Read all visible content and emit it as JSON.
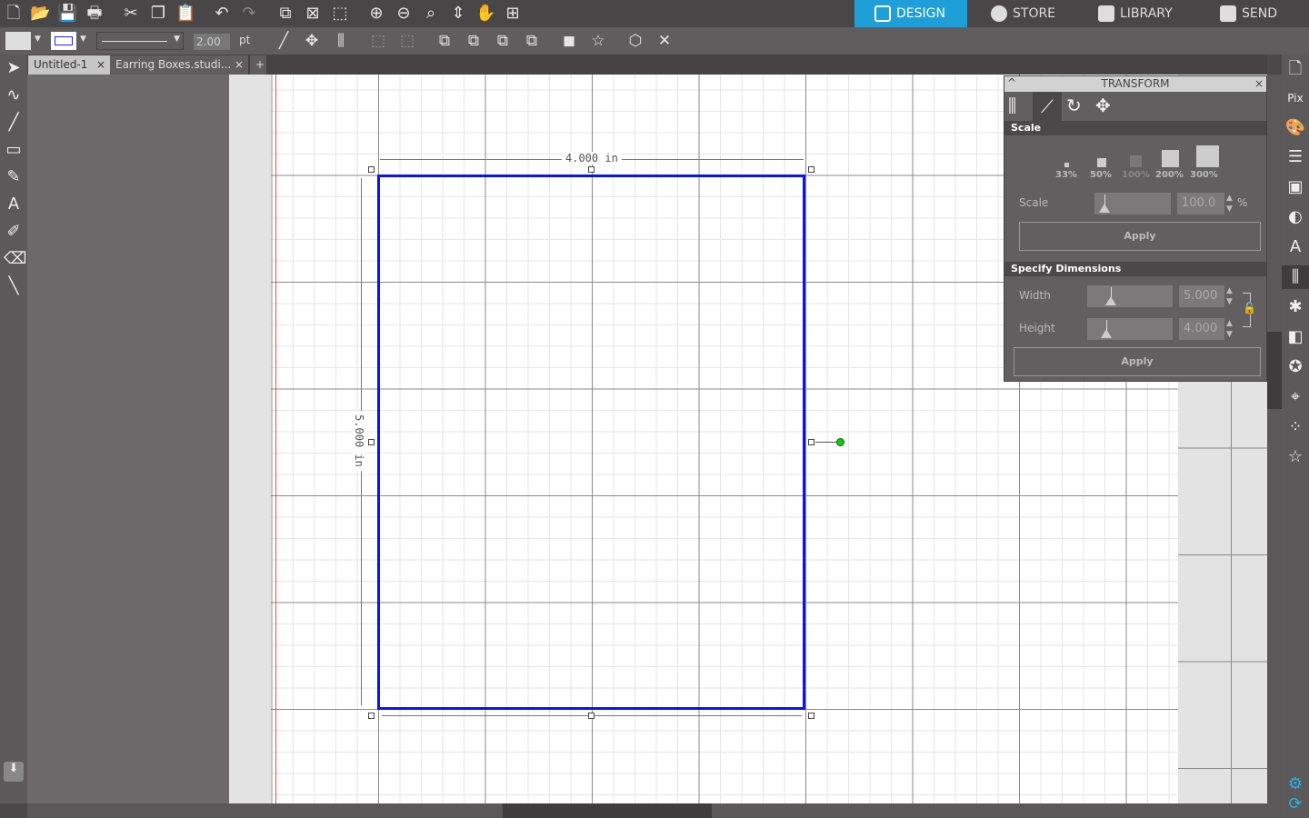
{
  "nav": {
    "tabs": [
      {
        "label": "DESIGN",
        "active": true
      },
      {
        "label": "STORE"
      },
      {
        "label": "LIBRARY"
      },
      {
        "label": "SEND"
      }
    ],
    "accent": "#1e9fd8"
  },
  "toolbar": {
    "line_width": "2.00",
    "line_unit": "pt"
  },
  "doc_tabs": [
    {
      "label": "Untitled-1",
      "close": "×"
    },
    {
      "label": "Earring Boxes.studi...",
      "close": "×"
    },
    {
      "label": "+"
    }
  ],
  "canvas": {
    "width_label": "4.000 in",
    "height_label": "5.000 in",
    "shape_color": "#0a14f0"
  },
  "transform": {
    "title": "TRANSFORM",
    "close": "×",
    "collapse": "^",
    "scale_section": "Scale",
    "presets": [
      "33%",
      "50%",
      "100%",
      "200%",
      "300%"
    ],
    "scale_label": "Scale",
    "scale_value": "100.0",
    "scale_unit": "%",
    "apply": "Apply",
    "dims_section": "Specify Dimensions",
    "width_label": "Width",
    "width_value": "5.000",
    "height_label": "Height",
    "height_value": "4.000"
  }
}
